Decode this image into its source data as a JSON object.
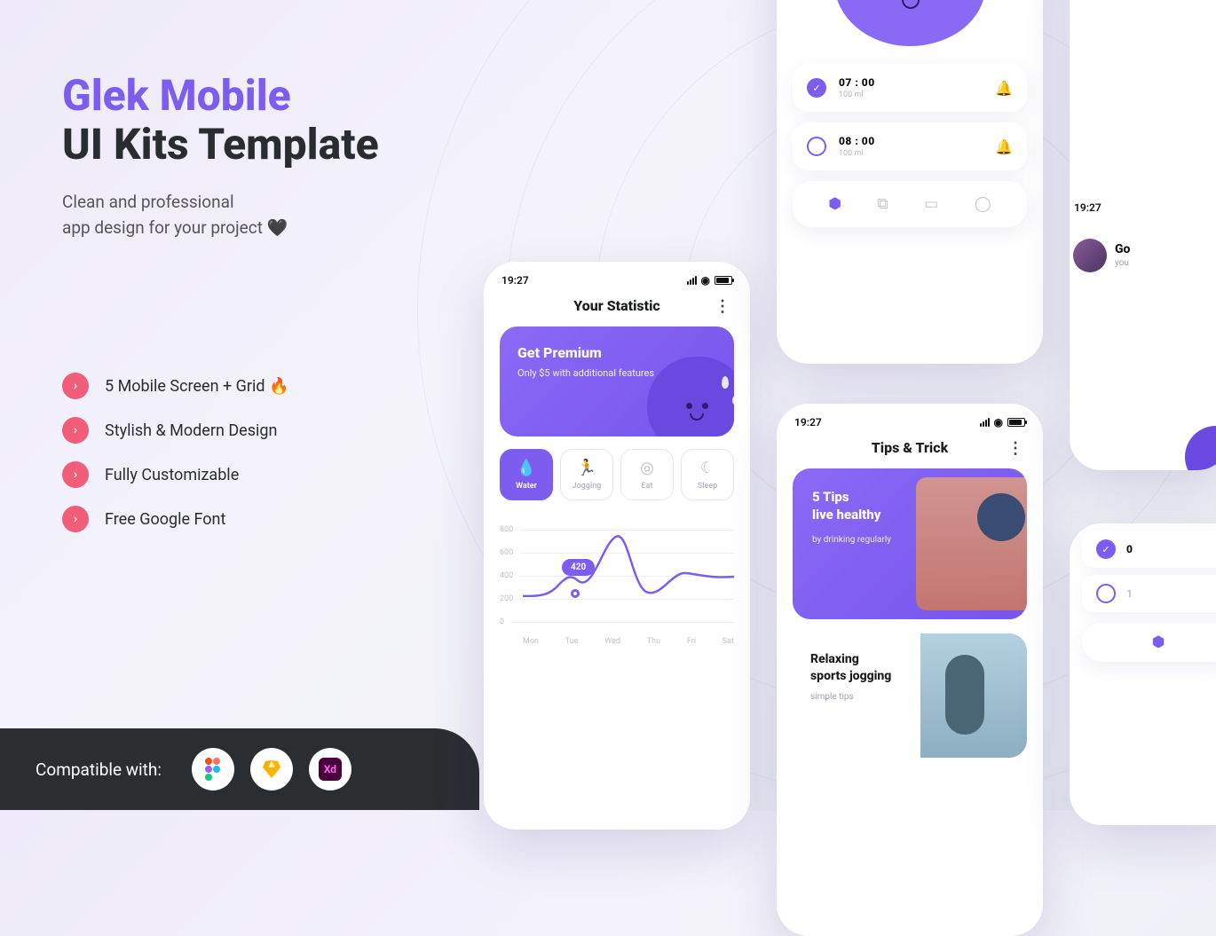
{
  "hero": {
    "title_line1": "Glek Mobile",
    "title_line2": "UI Kits Template",
    "subtitle": "Clean and professional\napp design for your project 🖤"
  },
  "features": [
    "5 Mobile Screen + Grid 🔥",
    "Stylish & Modern Design",
    "Fully Customizable",
    "Free Google Font"
  ],
  "compat": {
    "label": "Compatible with:",
    "apps": [
      "figma",
      "sketch",
      "xd"
    ]
  },
  "phone1": {
    "time": "19:27",
    "title": "Your Statistic",
    "premium": {
      "title": "Get Premium",
      "sub": "Only $5 with additional features"
    },
    "categories": [
      {
        "label": "Water",
        "active": true
      },
      {
        "label": "Jogging",
        "active": false
      },
      {
        "label": "Eat",
        "active": false
      },
      {
        "label": "Sleep",
        "active": false
      }
    ],
    "chart": {
      "yticks": [
        "800",
        "600",
        "400",
        "200",
        "0"
      ],
      "xlabs": [
        "Mon",
        "Tue",
        "Wed",
        "Thu",
        "Fri",
        "Sat"
      ],
      "badge": "420"
    }
  },
  "phone2": {
    "alarms": [
      {
        "time": "07 : 00",
        "vol": "100 ml",
        "checked": true,
        "bell": false
      },
      {
        "time": "08 : 00",
        "vol": "100 ml",
        "checked": false,
        "bell": true
      }
    ]
  },
  "phone3": {
    "time": "19:27",
    "title": "Tips & Trick",
    "tip1": {
      "title": "5 Tips\nlive healthy",
      "sub": "by drinking regularly"
    },
    "tip2": {
      "title": "Relaxing\nsports jogging",
      "sub": "simple tips"
    }
  },
  "phone5": {
    "time": "19:27",
    "greeting": "Go",
    "you": "you"
  },
  "chart_data": {
    "type": "line",
    "categories": [
      "Mon",
      "Tue",
      "Wed",
      "Thu",
      "Fri",
      "Sat"
    ],
    "values": [
      300,
      440,
      700,
      330,
      440,
      430
    ],
    "annotation": {
      "x": "Tue",
      "value": 420
    },
    "ylim": [
      0,
      800
    ],
    "ylabel": "",
    "xlabel": ""
  }
}
